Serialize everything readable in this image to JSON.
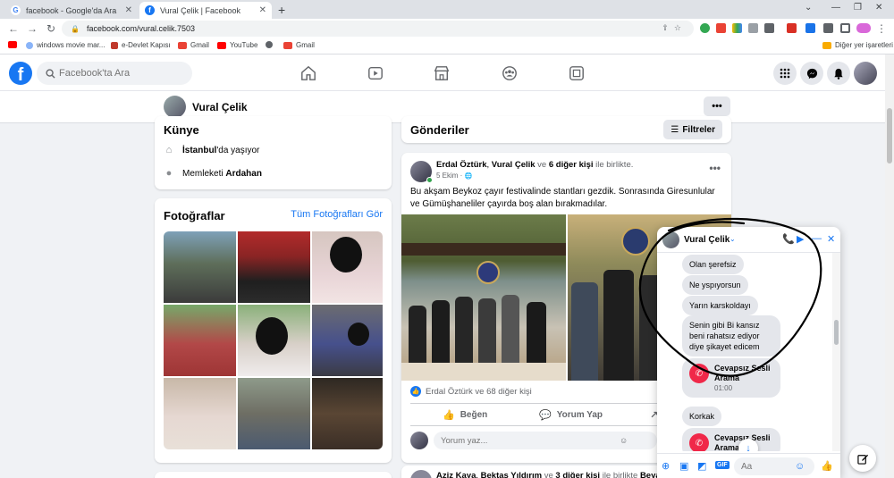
{
  "browser": {
    "tabs": [
      {
        "title": "facebook - Google'da Ara",
        "active": false
      },
      {
        "title": "Vural Çelik | Facebook",
        "active": true
      }
    ],
    "new_tab": "+",
    "url": "facebook.com/vural.celik.7503",
    "bookmarks": [
      {
        "label": "windows movie mar..."
      },
      {
        "label": "e-Devlet Kapısı"
      },
      {
        "label": "Gmail"
      },
      {
        "label": "YouTube"
      },
      {
        "label": "Gmail"
      }
    ],
    "other_bookmarks": "Diğer yer işaretleri"
  },
  "facebook": {
    "logo": "f",
    "search_placeholder": "Facebook'ta Ara",
    "profile": {
      "name": "Vural Çelik",
      "more": "•••"
    },
    "kunye": {
      "title": "Künye",
      "rows": [
        {
          "bold": "İstanbul",
          "rest": "'da yaşıyor"
        },
        {
          "prefix": "Memleketi ",
          "bold": "Ardahan"
        }
      ]
    },
    "photos": {
      "title": "Fotoğraflar",
      "all_link": "Tüm Fotoğrafları Gör"
    },
    "posts_header": {
      "title": "Gönderiler",
      "filter": "Filtreler"
    },
    "post": {
      "author": "Erdal Öztürk",
      "with_sep": ", ",
      "tagged": "Vural Çelik",
      "and": " ve ",
      "others": "6 diğer kişi",
      "together": " ile birlikte.",
      "date": "5 Ekim · ",
      "globe": "🌐",
      "text": "Bu akşam Beykoz çayır festivalinde stantları gezdik. Sonrasında Giresunlular ve Gümüşhaneliler çayırda boş alan bırakmadılar.",
      "likes": "Erdal Öztürk ve 68 diğer kişi",
      "like": "Beğen",
      "comment": "Yorum Yap",
      "comment_placeholder": "Yorum yaz..."
    },
    "post2": {
      "author": "Aziz Kaya",
      "with_sep": ", ",
      "tagged": "Bektaş Yıldırım",
      "and": " ve ",
      "others": "3 diğer kişi",
      "together": " ile birlikte ",
      "place": "Beyaz S"
    }
  },
  "chat": {
    "name": "Vural Çelik",
    "messages": [
      {
        "text": "Olan şerefsiz"
      },
      {
        "text": "Ne yspıyorsun"
      },
      {
        "text": "Yarın karskoldayı"
      },
      {
        "text": "Senin gibi Bi kansız beni rahatsız ediyor diye şikayet edicem"
      }
    ],
    "call1": {
      "title": "Cevapsız Sesli Arama",
      "time": "01:00"
    },
    "msg5": "Korkak",
    "call2": {
      "title": "Cevapsız Sesli Arama"
    },
    "input_placeholder": "Aa",
    "gif": "GIF"
  },
  "colors": {
    "fb_blue": "#1877f2",
    "background": "#f0f2f5",
    "online": "#31a24c",
    "missed_call": "#f02849"
  }
}
